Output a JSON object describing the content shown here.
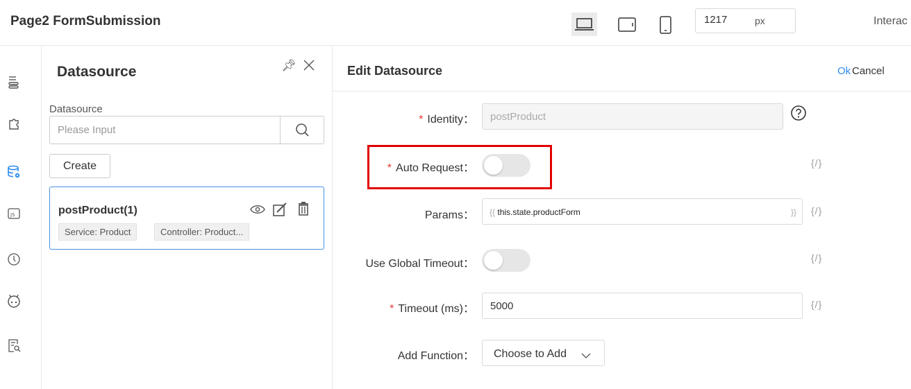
{
  "header": {
    "title": "Page2 FormSubmission",
    "devices": [
      "desktop-icon",
      "tablet-icon",
      "mobile-icon"
    ],
    "width_value": "1217",
    "width_unit": "px",
    "interact_label": "Interac"
  },
  "sidebar_icons": [
    "outline-icon",
    "component-icon",
    "datasource-icon",
    "js-icon",
    "history-icon",
    "assistant-icon",
    "review-icon"
  ],
  "datasource_panel": {
    "title": "Datasource",
    "search_label": "Datasource",
    "search_placeholder": "Please Input",
    "create_label": "Create",
    "items": [
      {
        "name": "postProduct(1)",
        "tags": [
          "Service: Product",
          "Controller: Product..."
        ]
      }
    ]
  },
  "edit_panel": {
    "title": "Edit Datasource",
    "ok_label": "Ok",
    "cancel_label": "Cancel",
    "code_icon_text": "{/}",
    "identity": {
      "label": "Identity：",
      "placeholder": "postProduct"
    },
    "auto_request": {
      "label": "Auto Request：",
      "on": false
    },
    "params": {
      "label": "Params：",
      "open": "{{",
      "value": "this.state.productForm",
      "close": "}}"
    },
    "use_global_timeout": {
      "label": "Use Global Timeout：",
      "on": false
    },
    "timeout": {
      "label": "Timeout (ms)：",
      "value": "5000"
    },
    "add_function": {
      "label": "Add Function：",
      "value": "Choose to Add"
    }
  },
  "colors": {
    "accent": "#2d8cf0",
    "required": "#e53935",
    "highlight": "#e10000",
    "selected_border": "#4a90e2"
  }
}
